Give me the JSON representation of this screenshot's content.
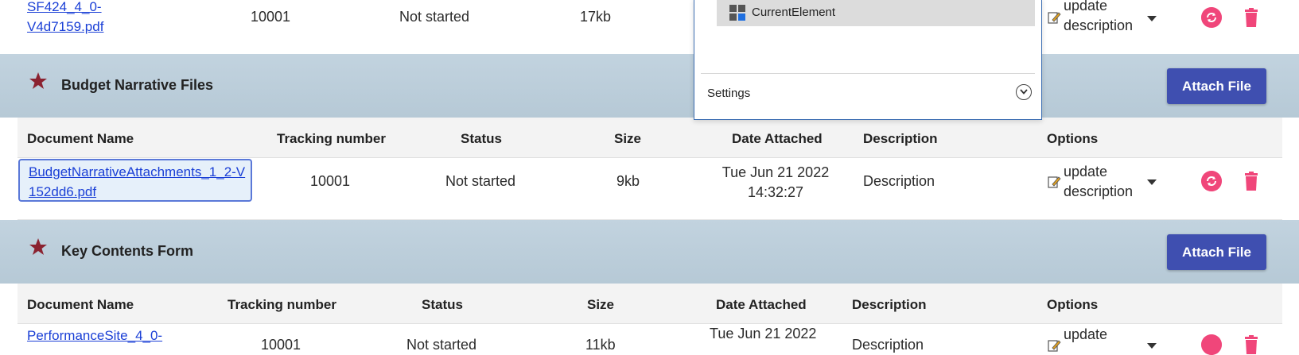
{
  "top_row": {
    "document_name": "SF424_4_0-V4d7159.pdf",
    "tracking_number": "10001",
    "status": "Not started",
    "size": "17kb",
    "update_label": "update description"
  },
  "popup": {
    "current_element_label": "CurrentElement",
    "settings_label": "Settings"
  },
  "sections": [
    {
      "title": "Budget Narrative Files",
      "attach_label": "Attach File",
      "columns": [
        "Document Name",
        "Tracking number",
        "Status",
        "Size",
        "Date Attached",
        "Description",
        "Options"
      ],
      "rows": [
        {
          "document_name": "BudgetNarrativeAttachments_1_2-V152dd6.pdf",
          "tracking_number": "10001",
          "status": "Not started",
          "size": "9kb",
          "date_attached": "Tue Jun 21 2022 14:32:27",
          "description": "Description",
          "update_label": "update description"
        }
      ]
    },
    {
      "title": "Key Contents Form",
      "attach_label": "Attach File",
      "columns": [
        "Document Name",
        "Tracking number",
        "Status",
        "Size",
        "Date Attached",
        "Description",
        "Options"
      ],
      "rows": [
        {
          "document_name": "PerformanceSite_4_0-",
          "tracking_number": "10001",
          "status": "Not started",
          "size": "11kb",
          "date_attached": "Tue Jun 21 2022",
          "description": "Description",
          "update_label": "update"
        }
      ]
    }
  ],
  "colors": {
    "band": "#b9ccd9",
    "attach_button": "#3f4fb0",
    "link": "#1a3fd6",
    "refresh": "#f0467a",
    "delete": "#f0467a",
    "star": "#8b2230"
  },
  "icons": [
    "edit-icon",
    "chevron-down-icon",
    "refresh-icon",
    "trash-icon",
    "star-icon",
    "grid-icon",
    "expand-icon"
  ]
}
